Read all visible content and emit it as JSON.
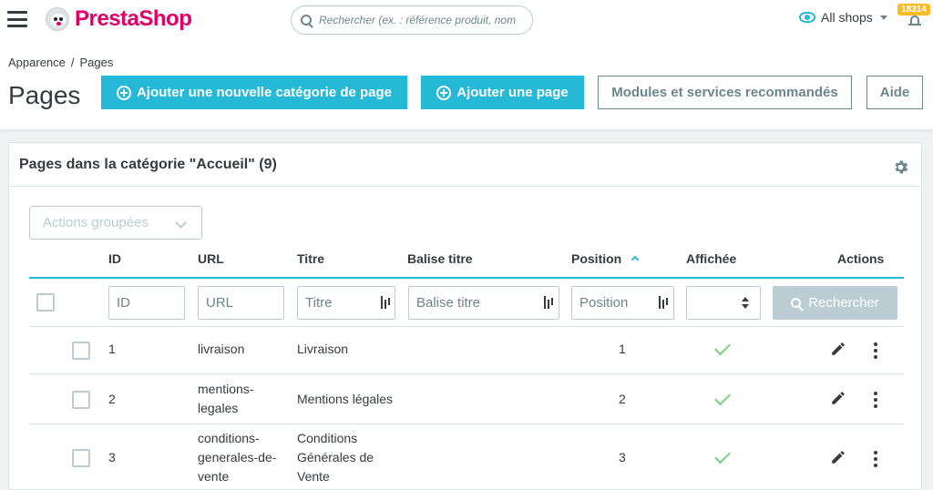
{
  "topbar": {
    "brand": "PrestaShop",
    "search_placeholder": "Rechercher (ex. : référence produit, nom",
    "shops_label": "All shops",
    "notifications_count": "18314"
  },
  "page_header": {
    "breadcrumb": [
      "Apparence",
      "/",
      "Pages"
    ],
    "title": "Pages",
    "buttons": {
      "add_category": "Ajouter une nouvelle catégorie de page",
      "add_page": "Ajouter une page",
      "modules": "Modules et services recommandés",
      "help": "Aide"
    }
  },
  "card": {
    "title": "Pages dans la catégorie \"Accueil\" (9)",
    "bulk_actions": "Actions groupées",
    "columns": {
      "id": "ID",
      "url": "URL",
      "title": "Titre",
      "meta_title": "Balise titre",
      "position": "Position",
      "displayed": "Affichée",
      "actions": "Actions"
    },
    "filters": {
      "id_placeholder": "ID",
      "url_placeholder": "URL",
      "title_placeholder": "Titre",
      "meta_title_placeholder": "Balise titre",
      "position_placeholder": "Position",
      "search_button": "Rechercher"
    },
    "rows": [
      {
        "id": "1",
        "url": "livraison",
        "title": "Livraison",
        "position": "1",
        "displayed": true
      },
      {
        "id": "2",
        "url": "mentions-legales",
        "url_lines": [
          "mentions-",
          "legales"
        ],
        "title": "Mentions légales",
        "position": "2",
        "displayed": true
      },
      {
        "id": "3",
        "url": "conditions-generales-de-vente",
        "url_lines": [
          "conditions-",
          "generales-de-",
          "vente"
        ],
        "title": "Conditions Générales de Vente",
        "title_lines": [
          "Conditions",
          "Générales de",
          "Vente"
        ],
        "position": "3",
        "displayed": true
      }
    ]
  },
  "colors": {
    "primary": "#25b9d7",
    "brand": "#df0067",
    "success": "#78d07d",
    "badge": "#fbbb22"
  }
}
